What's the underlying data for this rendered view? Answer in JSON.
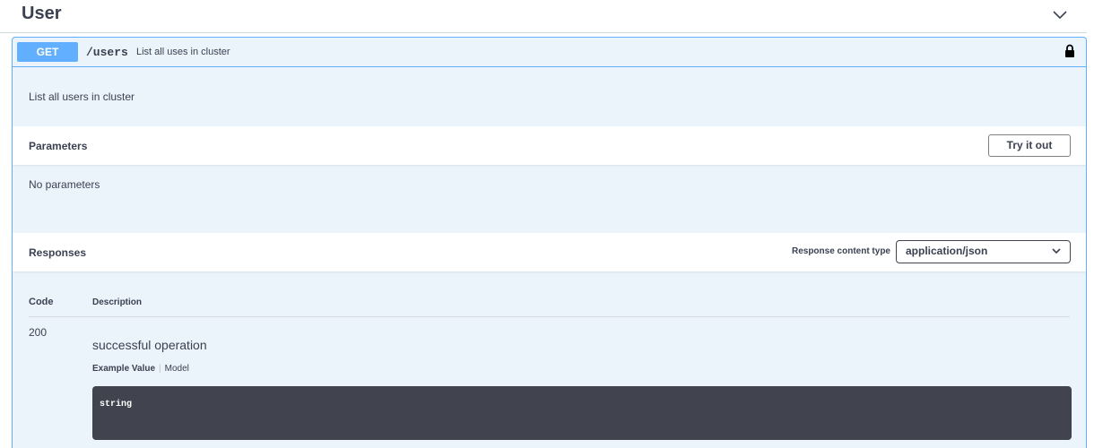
{
  "section": {
    "title": "User"
  },
  "operation": {
    "method": "GET",
    "path": "/users",
    "summary": "List all uses in cluster",
    "description": "List all users in cluster"
  },
  "parameters": {
    "title": "Parameters",
    "try_button": "Try it out",
    "empty_text": "No parameters"
  },
  "responses": {
    "title": "Responses",
    "content_type_label": "Response content type",
    "content_type_value": "application/json",
    "col_code": "Code",
    "col_description": "Description",
    "rows": [
      {
        "code": "200",
        "description": "successful operation",
        "tab_example": "Example Value",
        "tab_model": "Model",
        "example": "string"
      }
    ]
  },
  "colors": {
    "get_accent": "#61affe",
    "op_background": "#ebf3fb",
    "code_background": "#41444e"
  },
  "icons": {
    "collapse": "chevron-down-icon",
    "lock": "lock-icon",
    "select": "chevron-down-icon"
  }
}
